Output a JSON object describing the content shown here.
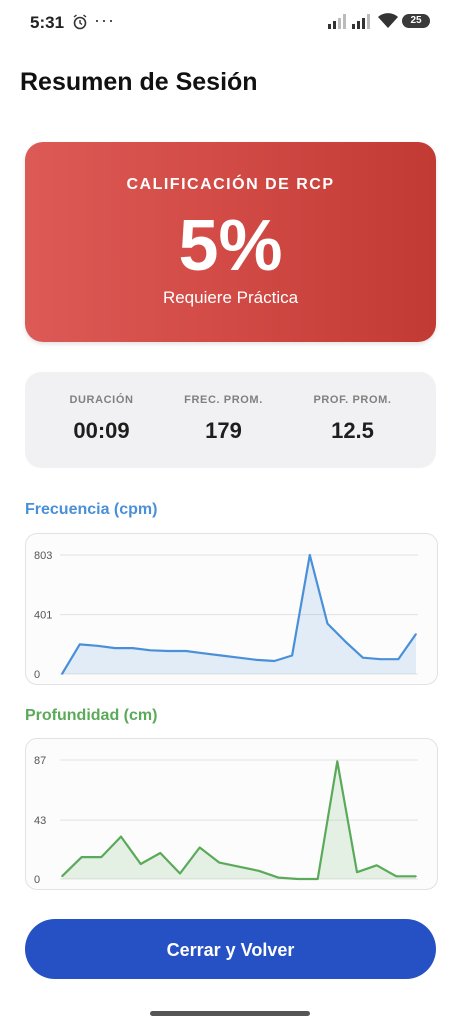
{
  "status_bar": {
    "time": "5:31",
    "dots": "···",
    "battery": "25",
    "icons": [
      "alarm-icon",
      "signal-icon",
      "signal-icon",
      "wifi-icon",
      "battery-icon"
    ]
  },
  "page": {
    "title": "Resumen de Sesión"
  },
  "score": {
    "label": "CALIFICACIÓN DE RCP",
    "value": "5%",
    "subtitle": "Requiere Práctica",
    "color": "#d24a45"
  },
  "stats": [
    {
      "label": "DURACIÓN",
      "value": "00:09"
    },
    {
      "label": "FREC. PROM.",
      "value": "179"
    },
    {
      "label": "PROF. PROM.",
      "value": "12.5"
    }
  ],
  "chart_data": [
    {
      "type": "area",
      "title": "Frecuencia (cpm)",
      "color": "#4a90d9",
      "y_ticks": [
        "803",
        "401",
        "0"
      ],
      "ylim": [
        0,
        803
      ],
      "grid": true,
      "x": [
        0,
        1,
        2,
        3,
        4,
        5,
        6,
        7,
        8,
        9,
        10,
        11,
        12,
        13,
        14,
        15,
        16,
        17,
        18,
        19,
        20
      ],
      "values": [
        0,
        200,
        190,
        175,
        175,
        160,
        155,
        155,
        140,
        125,
        110,
        95,
        88,
        125,
        803,
        340,
        220,
        110,
        100,
        100,
        270
      ]
    },
    {
      "type": "area",
      "title": "Profundidad (cm)",
      "color": "#5aaa5a",
      "y_ticks": [
        "87",
        "43",
        "0"
      ],
      "ylim": [
        0,
        87
      ],
      "grid": true,
      "x": [
        0,
        1,
        2,
        3,
        4,
        5,
        6,
        7,
        8,
        9,
        10,
        11,
        12,
        13,
        14,
        15,
        16,
        17,
        18
      ],
      "values": [
        2,
        16,
        16,
        31,
        11,
        19,
        4,
        23,
        12,
        9,
        6,
        1,
        0,
        0,
        86,
        5,
        10,
        2,
        2
      ]
    }
  ],
  "button": {
    "label": "Cerrar y Volver",
    "color": "#2551c4"
  }
}
